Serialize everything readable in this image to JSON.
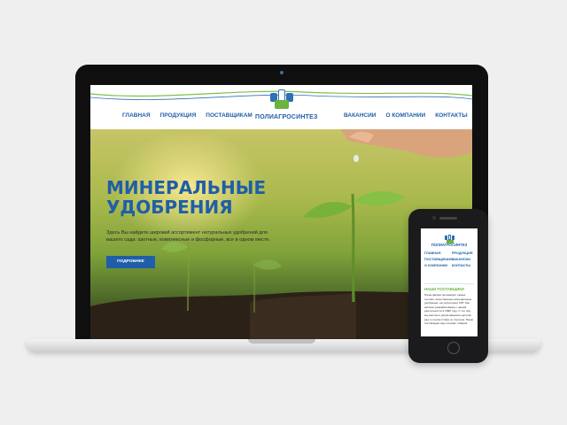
{
  "site": {
    "logo_text": "ПОЛИАГРОСИНТЕЗ",
    "nav_left": [
      "ГЛАВНАЯ",
      "ПРОДУКЦИЯ",
      "ПОСТАВЩИКАМ"
    ],
    "nav_right": [
      "ВАКАНСИИ",
      "О КОМПАНИИ",
      "КОНТАКТЫ"
    ]
  },
  "hero": {
    "title_line1": "МИНЕРАЛЬНЫЕ",
    "title_line2": "УДОБРЕНИЯ",
    "text": "Здесь Вы найдете широкий ассортимент натуральных удобрений для вашего сада: азотные, комплексные и фосфорные, все в одном месте.",
    "button_label": "ПОДРОБНЕЕ"
  },
  "mobile": {
    "logo_text": "ПОЛИАГРОСИНТЕЗ",
    "nav": [
      "ГЛАВНАЯ",
      "ПРОДУКЦИЯ",
      "ПОСТАВЩИКАМ",
      "ВАКАНСИИ",
      "О КОМПАНИИ",
      "КОНТАКТЫ"
    ],
    "heading": "НАШИ ПОСТАВЩИКИ",
    "text": "Наша фирма производит самые лучшие, качественные минеральные удобрения, на территории СНГ. Мы активно разрабатываем с нашей деятельности в 1998 году. С тех пор, мы растем и увеличиваемся десятки раз, в соответствии со спросом. Наши поставщики над сотнями товаров"
  },
  "colors": {
    "brand_blue": "#1f5ea8",
    "brand_green": "#6bb33c"
  }
}
